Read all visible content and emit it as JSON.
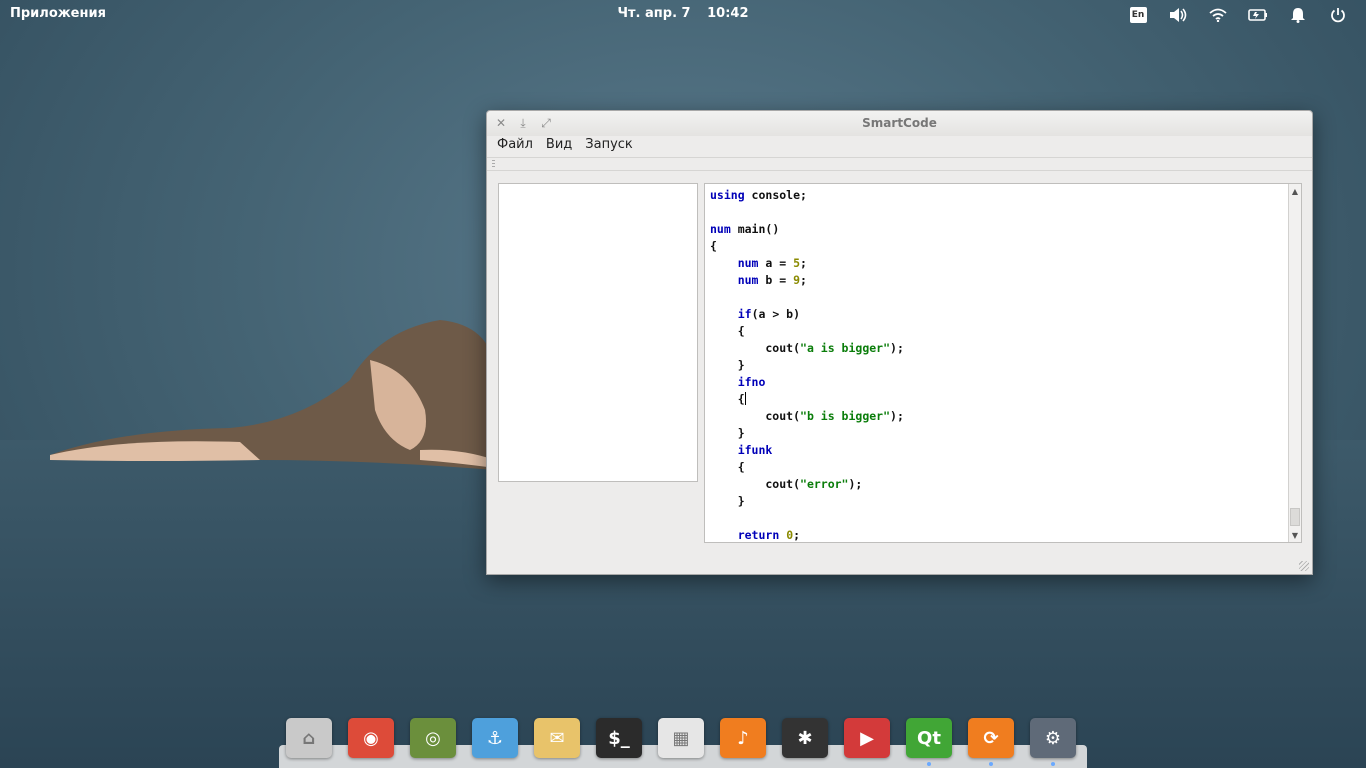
{
  "panel": {
    "applications_label": "Приложения",
    "date": "Чт. апр. 7",
    "time": "10:42",
    "keyboard_layout": "En",
    "tray_icons": [
      "keyboard-layout-icon",
      "volume-icon",
      "wifi-icon",
      "battery-icon",
      "notifications-icon",
      "power-icon"
    ]
  },
  "window": {
    "title": "SmartCode",
    "menu": [
      "Файл",
      "Вид",
      "Запуск"
    ]
  },
  "editor": {
    "lines": [
      [
        {
          "t": "using",
          "c": "kw"
        },
        {
          "t": " console;",
          "c": ""
        }
      ],
      [],
      [
        {
          "t": "num",
          "c": "kw"
        },
        {
          "t": " main()",
          "c": ""
        }
      ],
      [
        {
          "t": "{",
          "c": ""
        }
      ],
      [
        {
          "t": "    ",
          "c": ""
        },
        {
          "t": "num",
          "c": "kw"
        },
        {
          "t": " a = ",
          "c": ""
        },
        {
          "t": "5",
          "c": "num"
        },
        {
          "t": ";",
          "c": ""
        }
      ],
      [
        {
          "t": "    ",
          "c": ""
        },
        {
          "t": "num",
          "c": "kw"
        },
        {
          "t": " b = ",
          "c": ""
        },
        {
          "t": "9",
          "c": "num"
        },
        {
          "t": ";",
          "c": ""
        }
      ],
      [],
      [
        {
          "t": "    ",
          "c": ""
        },
        {
          "t": "if",
          "c": "kw"
        },
        {
          "t": "(a > b)",
          "c": ""
        }
      ],
      [
        {
          "t": "    {",
          "c": ""
        }
      ],
      [
        {
          "t": "        cout(",
          "c": ""
        },
        {
          "t": "\"a is bigger\"",
          "c": "str"
        },
        {
          "t": ");",
          "c": ""
        }
      ],
      [
        {
          "t": "    }",
          "c": ""
        }
      ],
      [
        {
          "t": "    ",
          "c": ""
        },
        {
          "t": "ifno",
          "c": "kw"
        }
      ],
      [
        {
          "t": "    {",
          "c": "caret"
        }
      ],
      [
        {
          "t": "        cout(",
          "c": ""
        },
        {
          "t": "\"b is bigger\"",
          "c": "str"
        },
        {
          "t": ");",
          "c": ""
        }
      ],
      [
        {
          "t": "    }",
          "c": ""
        }
      ],
      [
        {
          "t": "    ",
          "c": ""
        },
        {
          "t": "ifunk",
          "c": "kw"
        }
      ],
      [
        {
          "t": "    {",
          "c": ""
        }
      ],
      [
        {
          "t": "        cout(",
          "c": ""
        },
        {
          "t": "\"error\"",
          "c": "str"
        },
        {
          "t": ");",
          "c": ""
        }
      ],
      [
        {
          "t": "    }",
          "c": ""
        }
      ],
      [],
      [
        {
          "t": "    ",
          "c": ""
        },
        {
          "t": "return",
          "c": "kw"
        },
        {
          "t": " ",
          "c": ""
        },
        {
          "t": "0",
          "c": "num"
        },
        {
          "t": ";",
          "c": ""
        }
      ]
    ]
  },
  "dock": {
    "apps": [
      {
        "name": "files-app",
        "glyph": "⌂",
        "color": "#c9c9c9",
        "running": false
      },
      {
        "name": "chrome-app",
        "glyph": "◉",
        "color": "#dd4b39",
        "running": false
      },
      {
        "name": "browser-app",
        "glyph": "◎",
        "color": "#6b8f3c",
        "running": false
      },
      {
        "name": "anchor-app",
        "glyph": "⚓",
        "color": "#4ea0dc",
        "running": false
      },
      {
        "name": "mail-app",
        "glyph": "✉",
        "color": "#e8c36a",
        "running": false
      },
      {
        "name": "terminal-app",
        "glyph": "$_",
        "color": "#2b2b2b",
        "running": false
      },
      {
        "name": "calendar-app",
        "glyph": "▦",
        "color": "#e6e6e6",
        "running": false
      },
      {
        "name": "music-app",
        "glyph": "♪",
        "color": "#f07d1f",
        "running": false
      },
      {
        "name": "screenshot-app",
        "glyph": "✱",
        "color": "#333333",
        "running": false
      },
      {
        "name": "video-app",
        "glyph": "▶",
        "color": "#d33a3a",
        "running": false
      },
      {
        "name": "qt-creator-app",
        "glyph": "Qt",
        "color": "#41a636",
        "running": true
      },
      {
        "name": "update-app",
        "glyph": "⟳",
        "color": "#f07d1f",
        "running": true
      },
      {
        "name": "settings-app",
        "glyph": "⚙",
        "color": "#5f6a78",
        "running": true
      }
    ]
  }
}
